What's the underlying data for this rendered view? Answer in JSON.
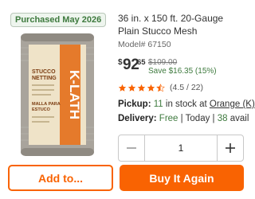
{
  "badge": {
    "label": "Purchased May 2026"
  },
  "product": {
    "title": "36 in. x 150 ft. 20-Gauge Plain Stucco Mesh",
    "model": "Model# 67150",
    "image_text": {
      "brand": "K-LATH",
      "line1": "STUCCO",
      "line2": "NETTING",
      "line3": "MALLA PARA",
      "line4": "ESTUCO"
    }
  },
  "price": {
    "dollar_sign": "$",
    "dollars": "92",
    "cents": "65",
    "was": "$109.00",
    "savings": "Save $16.35 (15%)"
  },
  "rating": {
    "stars": 4.5,
    "text": "(4.5 / 22)"
  },
  "pickup": {
    "label": "Pickup:",
    "count": "11",
    "middle": "in stock at",
    "store": "Orange (K)"
  },
  "delivery": {
    "label": "Delivery:",
    "value": "Free",
    "sep1": "|",
    "when": "Today",
    "sep2": "|",
    "count": "38",
    "suffix": "avail"
  },
  "quantity": {
    "value": "1"
  },
  "buttons": {
    "add_label": "Add to...",
    "buy_label": "Buy It Again"
  },
  "colors": {
    "accent": "#f96302",
    "green": "#3e7a3e"
  }
}
